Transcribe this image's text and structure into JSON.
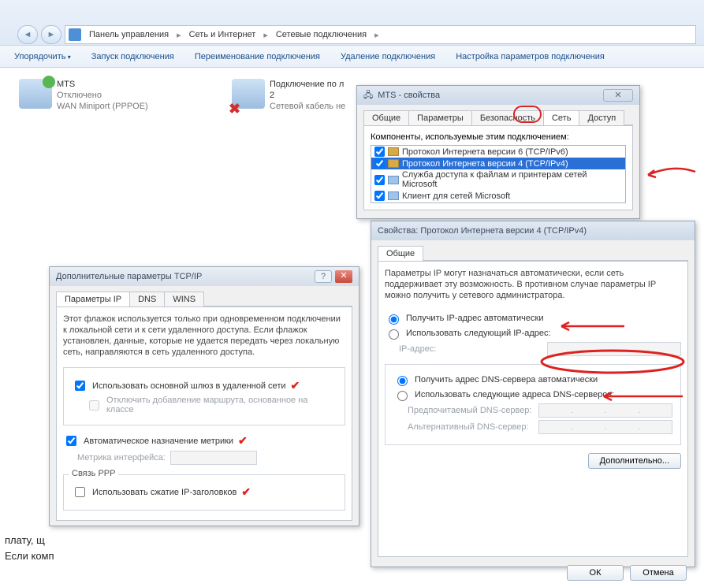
{
  "breadcrumb": {
    "a": "Панель управления",
    "b": "Сеть и Интернет",
    "c": "Сетевые подключения"
  },
  "toolbar": {
    "organize": "Упорядочить",
    "start": "Запуск подключения",
    "rename": "Переименование подключения",
    "delete": "Удаление подключения",
    "settings": "Настройка параметров подключения"
  },
  "conn1": {
    "name": "MTS",
    "status": "Отключено",
    "dev": "WAN Miniport (PPPOE)"
  },
  "conn2": {
    "name": "Подключение по л",
    "line2": "2",
    "status": "Сетевой кабель не"
  },
  "mts": {
    "title": "MTS - свойства",
    "tabs": {
      "general": "Общие",
      "params": "Параметры",
      "security": "Безопасность",
      "net": "Сеть",
      "access": "Доступ"
    },
    "components_label": "Компоненты, используемые этим подключением:",
    "items": {
      "ipv6": "Протокол Интернета версии 6 (TCP/IPv6)",
      "ipv4": "Протокол Интернета версии 4 (TCP/IPv4)",
      "fps": "Служба доступа к файлам и принтерам сетей Microsoft",
      "client": "Клиент для сетей Microsoft"
    }
  },
  "ipv4": {
    "title": "Свойства: Протокол Интернета версии 4 (TCP/IPv4)",
    "tab": "Общие",
    "desc": "Параметры IP могут назначаться автоматически, если сеть поддерживает эту возможность. В противном случае параметры IP можно получить у сетевого администратора.",
    "auto_ip": "Получить IP-адрес автоматически",
    "manual_ip": "Использовать следующий IP-адрес:",
    "ip_label": "IP-адрес:",
    "auto_dns": "Получить адрес DNS-сервера автоматически",
    "manual_dns": "Использовать следующие адреса DNS-серверов:",
    "dns1": "Предпочитаемый DNS-сервер:",
    "dns2": "Альтернативный DNS-сервер:",
    "advanced": "Дополнительно...",
    "ok": "ОК",
    "cancel": "Отмена"
  },
  "adv": {
    "title": "Дополнительные параметры TCP/IP",
    "tabs": {
      "ip": "Параметры IP",
      "dns": "DNS",
      "wins": "WINS"
    },
    "desc": "Этот флажок используется только при одновременном подключении к локальной сети и к сети удаленного доступа. Если флажок установлен, данные, которые не удается передать через локальную сеть, направляются в сеть удаленного доступа.",
    "use_gateway": "Использовать основной шлюз в удаленной сети",
    "disable_route": "Отключить добавление маршрута, основанное на классе",
    "auto_metric": "Автоматическое назначение метрики",
    "metric_label": "Метрика интерфейса:",
    "ppp": "Связь PPP",
    "ip_compress": "Использовать сжатие IP-заголовков"
  },
  "bg": {
    "t1": "плату, щ",
    "t2": "Если комп"
  }
}
